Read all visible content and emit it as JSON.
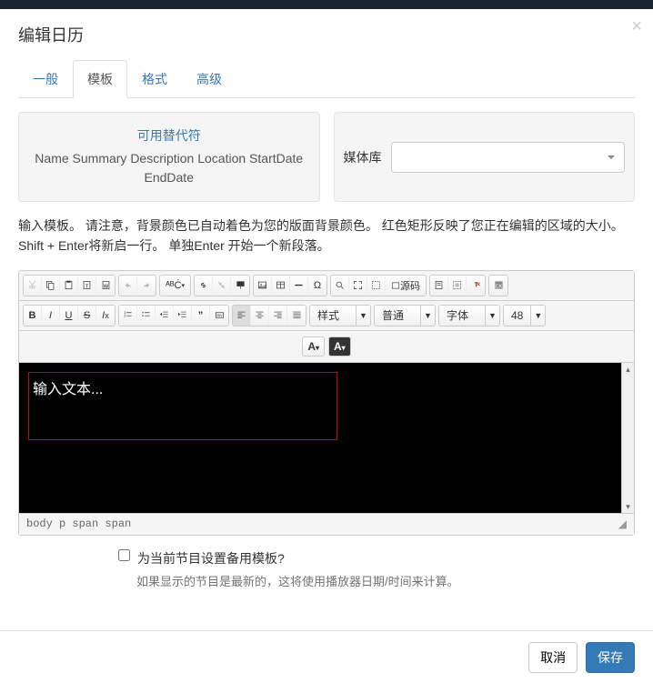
{
  "title": "编辑日历",
  "tabs": {
    "general": "一般",
    "template": "模板",
    "format": "格式",
    "advanced": "高级"
  },
  "substitution": {
    "heading": "可用替代符",
    "tokens": "Name Summary Description Location StartDate EndDate"
  },
  "media": {
    "label": "媒体库"
  },
  "help": "输入模板。 请注意，背景颜色已自动着色为您的版面背景颜色。 红色矩形反映了您正在编辑的区域的大小。 Shift + Enter将新启一行。 单独Enter 开始一个新段落。",
  "toolbar": {
    "source": "源码",
    "style": "样式",
    "normal": "普通",
    "font": "字体",
    "size": "48",
    "textcolor": "A",
    "bgcolor": "A"
  },
  "editor": {
    "placeholder": "输入文本...",
    "path": "body  p  span  span"
  },
  "fallback": {
    "checkbox": "为当前节目设置备用模板?",
    "help": "如果显示的节目是最新的，这将使用播放器日期/时间来计算。"
  },
  "buttons": {
    "cancel": "取消",
    "save": "保存"
  }
}
